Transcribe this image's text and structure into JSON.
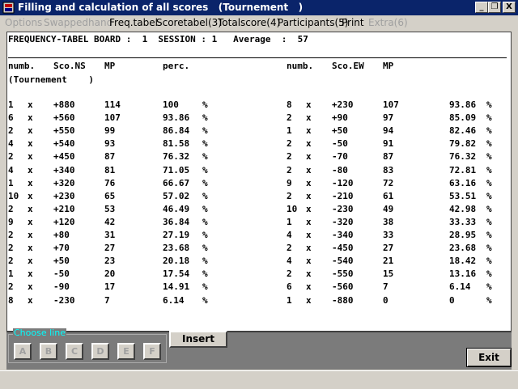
{
  "window": {
    "title": "Filling and calculation of all scores   (Tournement   )",
    "minimize_label": "_",
    "restore_label": "❐",
    "close_label": "X"
  },
  "menu": [
    "Options",
    "Swappedhand",
    "Freq.tabel",
    "Scoretabel(3)",
    "Totalscore(4)",
    "Participants(5)",
    "Print",
    "Extra(6)"
  ],
  "board": {
    "header": "FREQUENCY-TABEL BOARD :  1  SESSION : 1   Average  :  57",
    "left_headers": [
      "numb.",
      "Sco.NS",
      "MP",
      "perc."
    ],
    "right_headers": [
      "numb.",
      "Sco.EW",
      "MP"
    ],
    "subheader": "(Tournement    )",
    "times_symbol": "x",
    "percent_symbol": "%",
    "rows_ns": [
      {
        "numb": "1",
        "score": "+880",
        "mp": "114",
        "perc": "100"
      },
      {
        "numb": "6",
        "score": "+560",
        "mp": "107",
        "perc": "93.86"
      },
      {
        "numb": "2",
        "score": "+550",
        "mp": "99",
        "perc": "86.84"
      },
      {
        "numb": "4",
        "score": "+540",
        "mp": "93",
        "perc": "81.58"
      },
      {
        "numb": "2",
        "score": "+450",
        "mp": "87",
        "perc": "76.32"
      },
      {
        "numb": "4",
        "score": "+340",
        "mp": "81",
        "perc": "71.05"
      },
      {
        "numb": "1",
        "score": "+320",
        "mp": "76",
        "perc": "66.67"
      },
      {
        "numb": "10",
        "score": "+230",
        "mp": "65",
        "perc": "57.02"
      },
      {
        "numb": "2",
        "score": "+210",
        "mp": "53",
        "perc": "46.49"
      },
      {
        "numb": "9",
        "score": "+120",
        "mp": "42",
        "perc": "36.84"
      },
      {
        "numb": "2",
        "score": "+80",
        "mp": "31",
        "perc": "27.19"
      },
      {
        "numb": "2",
        "score": "+70",
        "mp": "27",
        "perc": "23.68"
      },
      {
        "numb": "2",
        "score": "+50",
        "mp": "23",
        "perc": "20.18"
      },
      {
        "numb": "1",
        "score": "-50",
        "mp": "20",
        "perc": "17.54"
      },
      {
        "numb": "2",
        "score": "-90",
        "mp": "17",
        "perc": "14.91"
      },
      {
        "numb": "8",
        "score": "-230",
        "mp": "7",
        "perc": "6.14"
      }
    ],
    "rows_ew": [
      {
        "numb": "8",
        "score": "+230",
        "mp": "107",
        "perc": "93.86"
      },
      {
        "numb": "2",
        "score": "+90",
        "mp": "97",
        "perc": "85.09"
      },
      {
        "numb": "1",
        "score": "+50",
        "mp": "94",
        "perc": "82.46"
      },
      {
        "numb": "2",
        "score": "-50",
        "mp": "91",
        "perc": "79.82"
      },
      {
        "numb": "2",
        "score": "-70",
        "mp": "87",
        "perc": "76.32"
      },
      {
        "numb": "2",
        "score": "-80",
        "mp": "83",
        "perc": "72.81"
      },
      {
        "numb": "9",
        "score": "-120",
        "mp": "72",
        "perc": "63.16"
      },
      {
        "numb": "2",
        "score": "-210",
        "mp": "61",
        "perc": "53.51"
      },
      {
        "numb": "10",
        "score": "-230",
        "mp": "49",
        "perc": "42.98"
      },
      {
        "numb": "1",
        "score": "-320",
        "mp": "38",
        "perc": "33.33"
      },
      {
        "numb": "4",
        "score": "-340",
        "mp": "33",
        "perc": "28.95"
      },
      {
        "numb": "2",
        "score": "-450",
        "mp": "27",
        "perc": "23.68"
      },
      {
        "numb": "4",
        "score": "-540",
        "mp": "21",
        "perc": "18.42"
      },
      {
        "numb": "2",
        "score": "-550",
        "mp": "15",
        "perc": "13.16"
      },
      {
        "numb": "6",
        "score": "-560",
        "mp": "7",
        "perc": "6.14"
      },
      {
        "numb": "1",
        "score": "-880",
        "mp": "0",
        "perc": "0"
      }
    ]
  },
  "controls": {
    "choose_line_label": "Choose line",
    "line_buttons": [
      "A",
      "B",
      "C",
      "D",
      "E",
      "F"
    ],
    "insert_label": "Insert",
    "exit_label": "Exit"
  }
}
